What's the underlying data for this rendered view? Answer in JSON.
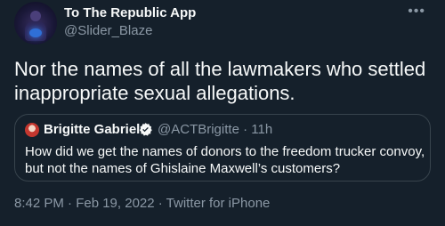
{
  "tweet": {
    "author_name": "To The Republic App",
    "author_handle": "@Slider_Blaze",
    "more_icon": "more-horizontal-icon",
    "text": "Nor the names of all the lawmakers who settled inappropriate sexual allegations.",
    "footer": "8:42 PM · Feb 19, 2022 · Twitter for iPhone"
  },
  "quote": {
    "author_name": "Brigitte Gabriel",
    "verified_icon": "verified-badge-icon",
    "meta": "@ACTBrigitte · 11h",
    "text": "How did we get the names of donors to the freedom trucker convoy, but not the names of Ghislaine Maxwell’s customers?"
  },
  "colors": {
    "background": "#15202b",
    "primary_text": "#f7f9f9",
    "secondary_text": "#8b98a5",
    "border": "#38444d",
    "verified": "#1d9bf0"
  }
}
